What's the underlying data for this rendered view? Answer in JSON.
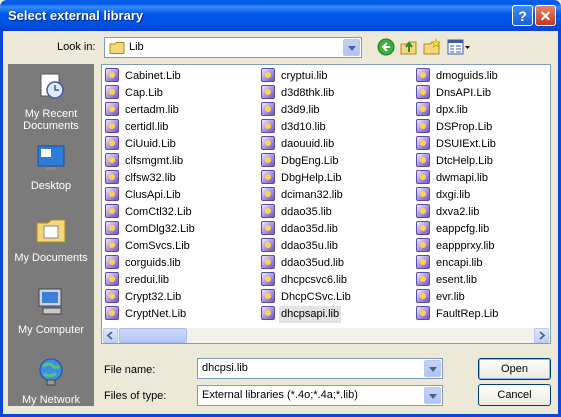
{
  "window": {
    "title": "Select external library"
  },
  "toolbar": {
    "look_in_label": "Look in:",
    "look_in_value": "Lib"
  },
  "places": [
    {
      "label": "My Recent Documents"
    },
    {
      "label": "Desktop"
    },
    {
      "label": "My Documents"
    },
    {
      "label": "My Computer"
    },
    {
      "label": "My Network"
    }
  ],
  "files": {
    "columns": [
      [
        "Cabinet.Lib",
        "Cap.Lib",
        "certadm.lib",
        "certidl.lib",
        "CiUuid.Lib",
        "clfsmgmt.lib",
        "clfsw32.lib",
        "ClusApi.Lib",
        "ComCtl32.Lib",
        "ComDlg32.Lib",
        "ComSvcs.Lib",
        "corguids.lib",
        "credui.lib",
        "Crypt32.Lib",
        "CryptNet.Lib"
      ],
      [
        "cryptui.lib",
        "d3d8thk.lib",
        "d3d9.lib",
        "d3d10.lib",
        "daouuid.lib",
        "DbgEng.Lib",
        "DbgHelp.Lib",
        "dciman32.lib",
        "ddao35.lib",
        "ddao35d.lib",
        "ddao35u.lib",
        "ddao35ud.lib",
        "dhcpcsvc6.lib",
        "DhcpCSvc.Lib",
        "dhcpsapi.lib"
      ],
      [
        "dmoguids.lib",
        "DnsAPI.Lib",
        "dpx.lib",
        "DSProp.Lib",
        "DSUIExt.Lib",
        "DtcHelp.Lib",
        "dwmapi.lib",
        "dxgi.lib",
        "dxva2.lib",
        "eappcfg.lib",
        "eappprxy.lib",
        "encapi.lib",
        "esent.lib",
        "evr.lib",
        "FaultRep.Lib"
      ]
    ],
    "selected": "dhcpsapi.lib"
  },
  "filename": {
    "label": "File name:",
    "value": "dhcpsi.lib"
  },
  "filetype": {
    "label": "Files of type:",
    "value": "External libraries (*.4o;*.4a;*.lib)"
  },
  "buttons": {
    "open": "Open",
    "cancel": "Cancel"
  }
}
